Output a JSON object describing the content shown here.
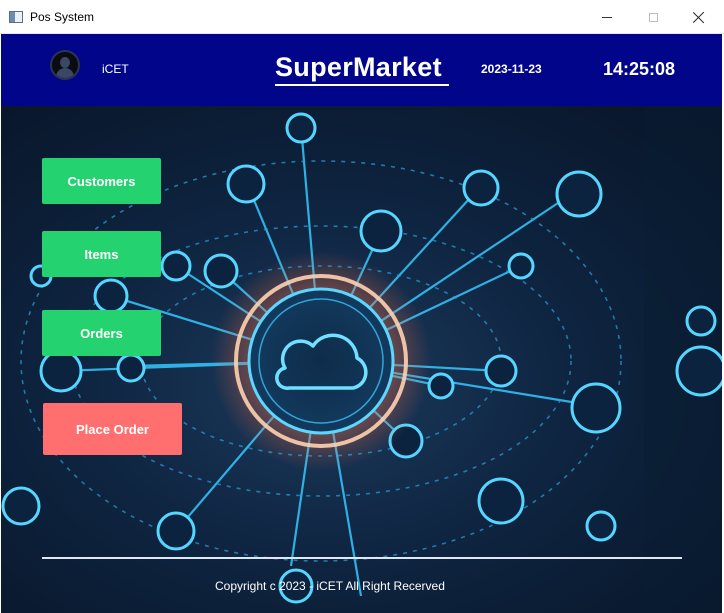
{
  "window": {
    "title": "Pos System"
  },
  "header": {
    "user_name": "iCET",
    "brand": "SuperMarket",
    "date": "2023-11-23",
    "time": "14:25:08",
    "background_color": "#00058a"
  },
  "nav": {
    "customers_label": "Customers",
    "items_label": "Items",
    "orders_label": "Orders",
    "place_order_label": "Place Order",
    "primary_color": "#24d270",
    "accent_color": "#ff6f6f"
  },
  "footer": {
    "copyright": "Copyright c 2023 - iCET All Right Recerved"
  },
  "icons": {
    "avatar": "user-avatar-icon",
    "cloud": "cloud-icon",
    "window_app": "app-window-icon"
  }
}
